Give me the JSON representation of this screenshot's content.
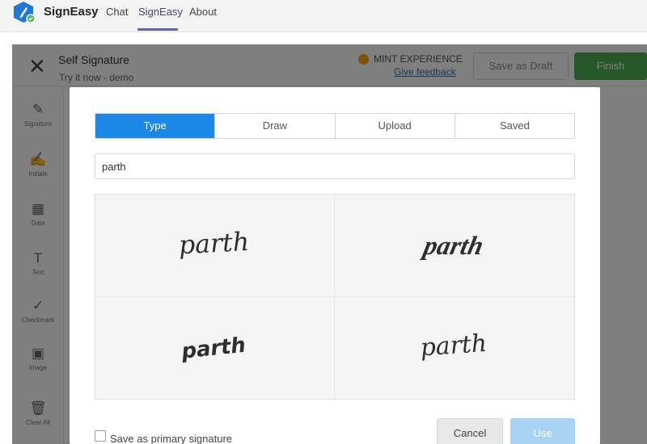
{
  "topbar": {
    "app_name": "SignEasy",
    "tabs": [
      {
        "label": "Chat"
      },
      {
        "label": "SignEasy"
      },
      {
        "label": "About"
      }
    ],
    "active_tab": "SignEasy",
    "logo_icon": "signeasy-pen-logo-icon"
  },
  "document": {
    "title": "Self Signature",
    "subtitle": "Try it now - demo",
    "mint_label": "MINT EXPERIENCE",
    "feedback_label": "Give feedback",
    "draft_label": "Save as Draft",
    "finish_label": "Finish"
  },
  "tools": [
    {
      "label": "Signature",
      "icon": "pen-icon"
    },
    {
      "label": "Initials",
      "icon": "initials-icon"
    },
    {
      "label": "Date",
      "icon": "calendar-icon"
    },
    {
      "label": "Text",
      "icon": "text-icon"
    },
    {
      "label": "Checkmark",
      "icon": "checkmark-icon"
    },
    {
      "label": "Image",
      "icon": "image-icon"
    },
    {
      "label": "Clear All",
      "icon": "trash-icon"
    }
  ],
  "modal": {
    "tabs": [
      {
        "label": "Type"
      },
      {
        "label": "Draw"
      },
      {
        "label": "Upload"
      },
      {
        "label": "Saved"
      }
    ],
    "active_tab": "Type",
    "name_value": "parth",
    "signatures": [
      {
        "text": "parth",
        "style": "upright-script"
      },
      {
        "text": "parth",
        "style": "bold-slanted-script"
      },
      {
        "text": "parth",
        "style": "heavy-italic-script"
      },
      {
        "text": "parth",
        "style": "thin-script"
      }
    ],
    "primary_label": "Save as primary signature",
    "cancel_label": "Cancel",
    "use_label": "Use"
  },
  "colors": {
    "accent_blue": "#1b87e6",
    "finish_green": "#4caf50",
    "teams_purple": "#6264a7",
    "mint_gold": "#f0a800"
  }
}
